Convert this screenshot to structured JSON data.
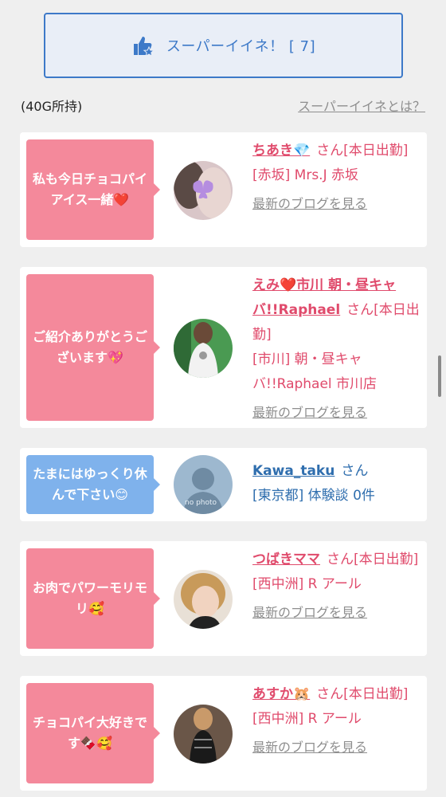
{
  "super_button": {
    "label": "スーパーイイネ！ [ 7]",
    "icon": "thumbs-up-star-icon"
  },
  "owned_points": "(40G所持)",
  "what_link": "スーパーイイネとは？",
  "cards": [
    {
      "message": "私も今日チョコパイアイス一緒❤️",
      "bubble_color": "#f4899b",
      "name": "ちあき💎",
      "san": "さん[本日出勤]",
      "shop": "[赤坂] Mrs.J 赤坂",
      "blog": "最新のブログを見る"
    },
    {
      "message": "ご紹介ありがとうございます💖",
      "bubble_color": "#f4899b",
      "name": "えみ❤️市川 朝・昼キャバ!!Raphael",
      "san": "さん[本日出勤]",
      "shop": "[市川] 朝・昼キャバ!!Raphael 市川店",
      "blog": "最新のブログを見る"
    },
    {
      "message": "たまにはゆっくり休んで下さい😊",
      "bubble_color": "#7fb2ec",
      "name": "Kawa_taku",
      "san": "さん",
      "shop": "[東京都] 体験談 0件",
      "avatar_text": "no photo"
    },
    {
      "message": "お肉でパワーモリモリ🥰",
      "bubble_color": "#f4899b",
      "name": "つばきママ",
      "san": "さん[本日出勤]",
      "shop": "[西中洲] R アール",
      "blog": "最新のブログを見る"
    },
    {
      "message": "チョコパイ大好きです🍫🥰",
      "bubble_color": "#f4899b",
      "name": "あすか🐹",
      "san": "さん[本日出勤]",
      "shop": "[西中洲] R アール",
      "blog": "最新のブログを見る"
    }
  ]
}
